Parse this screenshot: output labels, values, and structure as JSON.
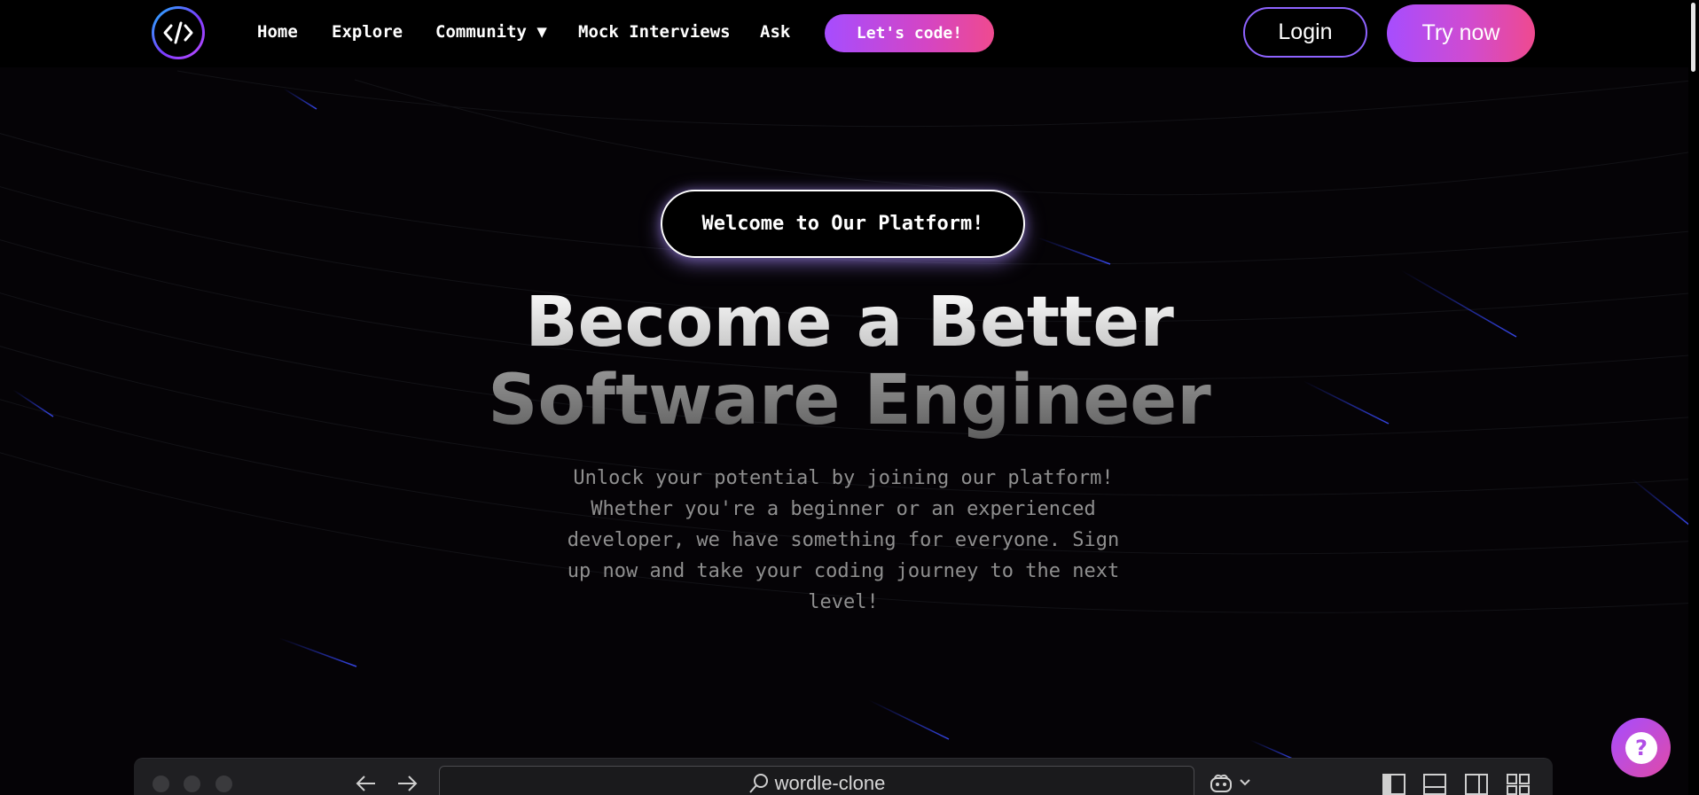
{
  "nav": {
    "logo_icon": "code-brackets-icon",
    "links": {
      "home": "Home",
      "explore": "Explore",
      "community": "Community ▼",
      "mock_interviews": "Mock Interviews",
      "ask": "Ask"
    },
    "cta": "Let's code!",
    "login": "Login",
    "try_now": "Try now"
  },
  "hero": {
    "badge": "Welcome to Our Platform!",
    "headline_line1": "Become a Better",
    "headline_line2": "Software Engineer",
    "subtext": "Unlock your potential by joining our platform! Whether you're a beginner or an experienced developer, we have something for everyone. Sign up now and take your coding journey to the next level!"
  },
  "browser": {
    "url": "wordle-clone",
    "icons": [
      "back-arrow-icon",
      "forward-arrow-icon",
      "search-icon",
      "copilot-icon",
      "chevron-down-icon",
      "layout-sidebar-left-icon",
      "layout-panel-icon",
      "layout-sidebar-right-icon",
      "layout-grid-icon"
    ]
  },
  "help": {
    "icon": "question-mark-icon"
  },
  "colors": {
    "background": "#050306",
    "accent_purple": "#a64dff",
    "accent_pink": "#ef4a8f",
    "login_border": "#8e63ff"
  }
}
